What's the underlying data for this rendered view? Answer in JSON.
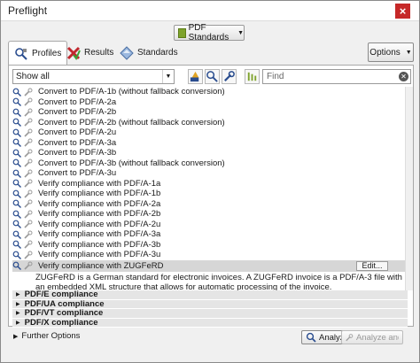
{
  "window": {
    "title": "Preflight",
    "close_label": "×"
  },
  "toolbar": {
    "library_label": "PDF Standards"
  },
  "tabs": [
    {
      "label": "Profiles",
      "icon": "profiles-icon"
    },
    {
      "label": "Results",
      "icon": "results-icon"
    },
    {
      "label": "Standards",
      "icon": "standards-icon"
    }
  ],
  "options_label": "Options",
  "filter": {
    "selected": "Show all",
    "find_placeholder": "Find"
  },
  "profiles": [
    "Convert to PDF/A-1b (without fallback conversion)",
    "Convert to PDF/A-2a",
    "Convert to PDF/A-2b",
    "Convert to PDF/A-2b (without fallback conversion)",
    "Convert to PDF/A-2u",
    "Convert to PDF/A-3a",
    "Convert to PDF/A-3b",
    "Convert to PDF/A-3b (without fallback conversion)",
    "Convert to PDF/A-3u",
    "Verify compliance with PDF/A-1a",
    "Verify compliance with PDF/A-1b",
    "Verify compliance with PDF/A-2a",
    "Verify compliance with PDF/A-2b",
    "Verify compliance with PDF/A-2u",
    "Verify compliance with PDF/A-3a",
    "Verify compliance with PDF/A-3b",
    "Verify compliance with PDF/A-3u"
  ],
  "selected_profile": {
    "label": "Verify compliance with ZUGFeRD",
    "edit_label": "Edit...",
    "description": "ZUGFeRD is a German standard for electronic invoices. A ZUGFeRD invoice is a PDF/A-3 file with an embedded XML structure that allows for automatic processing of the invoice."
  },
  "groups": [
    "PDF/E compliance",
    "PDF/UA compliance",
    "PDF/VT compliance",
    "PDF/X compliance"
  ],
  "further_options_label": "Further Options",
  "analyze_label": "Analyze",
  "analyze_fix_label": "Analyze and fix"
}
